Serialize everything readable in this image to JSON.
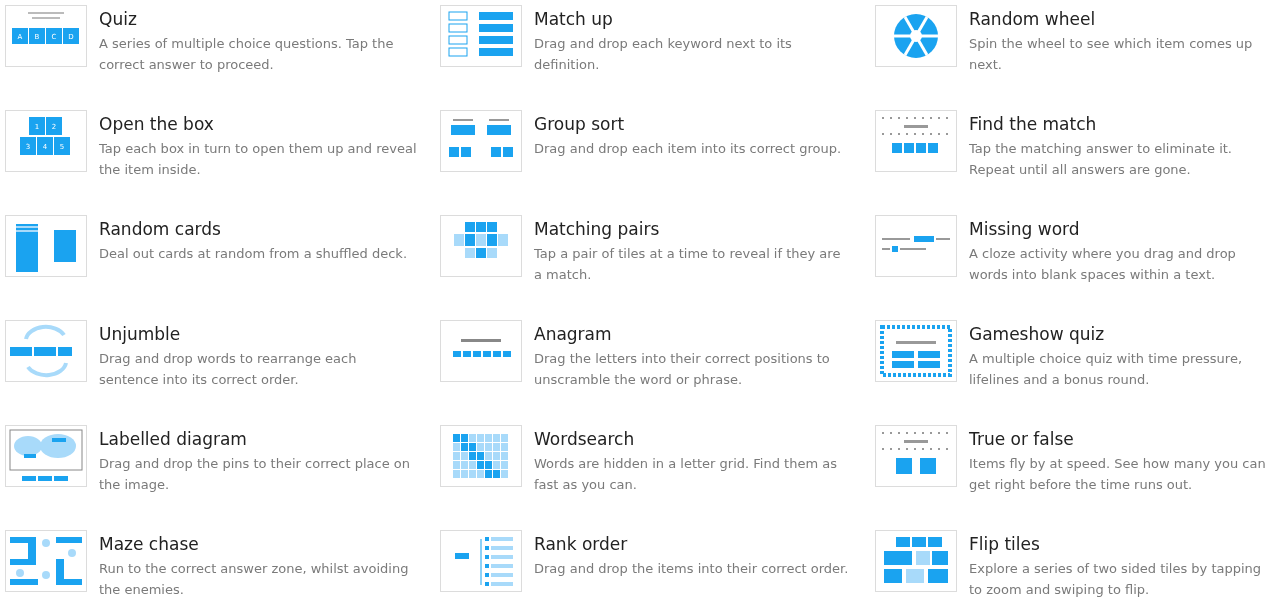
{
  "templates": [
    {
      "kind": "quiz",
      "title": "Quiz",
      "description": "A series of multiple choice questions. Tap the correct answer to proceed.",
      "tiles": [
        "A",
        "B",
        "C",
        "D"
      ]
    },
    {
      "kind": "match-up",
      "title": "Match up",
      "description": "Drag and drop each keyword next to its definition."
    },
    {
      "kind": "wheel",
      "title": "Random wheel",
      "description": "Spin the wheel to see which item comes up next."
    },
    {
      "kind": "open-box",
      "title": "Open the box",
      "description": "Tap each box in turn to open them up and reveal the item inside.",
      "tiles": [
        "1",
        "2",
        "3",
        "4",
        "5"
      ]
    },
    {
      "kind": "group-sort",
      "title": "Group sort",
      "description": "Drag and drop each item into its correct group."
    },
    {
      "kind": "find-match",
      "title": "Find the match",
      "description": "Tap the matching answer to eliminate it. Repeat until all answers are gone."
    },
    {
      "kind": "cards",
      "title": "Random cards",
      "description": "Deal out cards at random from a shuffled deck."
    },
    {
      "kind": "pairs",
      "title": "Matching pairs",
      "description": "Tap a pair of tiles at a time to reveal if they are a match."
    },
    {
      "kind": "missing-word",
      "title": "Missing word",
      "description": "A cloze activity where you drag and drop words into blank spaces within a text."
    },
    {
      "kind": "unjumble",
      "title": "Unjumble",
      "description": "Drag and drop words to rearrange each sentence into its correct order."
    },
    {
      "kind": "anagram",
      "title": "Anagram",
      "description": "Drag the letters into their correct positions to unscramble the word or phrase."
    },
    {
      "kind": "gameshow",
      "title": "Gameshow quiz",
      "description": "A multiple choice quiz with time pressure, lifelines and a bonus round."
    },
    {
      "kind": "diagram",
      "title": "Labelled diagram",
      "description": "Drag and drop the pins to their correct place on the image."
    },
    {
      "kind": "wordsearch",
      "title": "Wordsearch",
      "description": "Words are hidden in a letter grid. Find them as fast as you can."
    },
    {
      "kind": "true-false",
      "title": "True or false",
      "description": "Items fly by at speed. See how many you can get right before the time runs out."
    },
    {
      "kind": "maze",
      "title": "Maze chase",
      "description": "Run to the correct answer zone, whilst avoiding the enemies."
    },
    {
      "kind": "rank-order",
      "title": "Rank order",
      "description": "Drag and drop the items into their correct order."
    },
    {
      "kind": "flip-tiles",
      "title": "Flip tiles",
      "description": "Explore a series of two sided tiles by tapping to zoom and swiping to flip."
    }
  ]
}
